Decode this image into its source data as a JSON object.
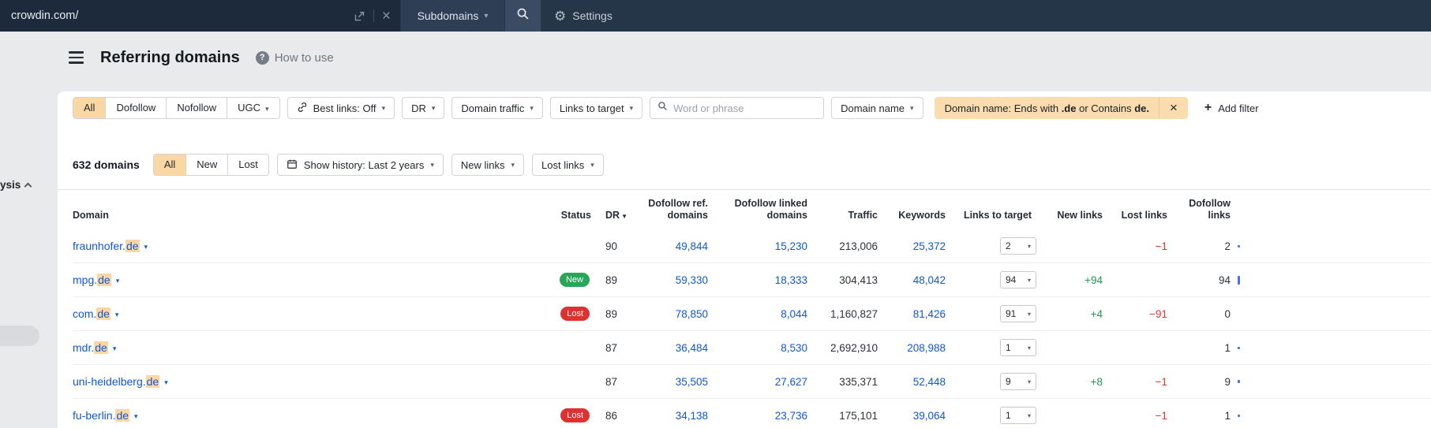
{
  "topbar": {
    "url_value": "crowdin.com/",
    "mode_selector": "Subdomains",
    "settings_label": "Settings"
  },
  "header": {
    "title": "Referring domains",
    "help_label": "How to use"
  },
  "sidebar": {
    "cut_label": "ysis"
  },
  "filters": {
    "segments": {
      "all": "All",
      "dofollow": "Dofollow",
      "nofollow": "Nofollow",
      "ugc": "UGC"
    },
    "best_links": "Best links: Off",
    "dr": "DR",
    "domain_traffic": "Domain traffic",
    "links_to_target": "Links to target",
    "search_placeholder": "Word or phrase",
    "domain_name": "Domain name",
    "chip": {
      "prefix": "Domain name: Ends with ",
      "bold1": ".de",
      "middle": " or Contains ",
      "bold2": "de."
    },
    "add_filter": "Add filter"
  },
  "toolbar": {
    "count": "632 domains",
    "segments": {
      "all": "All",
      "new": "New",
      "lost": "Lost"
    },
    "show_history": "Show history: Last 2 years",
    "new_links": "New links",
    "lost_links": "Lost links"
  },
  "table": {
    "headers": [
      "Domain",
      "Status",
      "DR",
      "Dofollow ref. domains",
      "Dofollow linked domains",
      "Traffic",
      "Keywords",
      "Links to target",
      "New links",
      "Lost links",
      "Dofollow links"
    ],
    "rows": [
      {
        "domain_prefix": "fraunhofer.",
        "domain_hl": "de",
        "status": "",
        "dr": "90",
        "dofollow_ref": "49,844",
        "dofollow_linked": "15,230",
        "traffic": "213,006",
        "keywords": "25,372",
        "links_to_target": "2",
        "new_links": "",
        "lost_links": "−1",
        "dofollow_links": "2"
      },
      {
        "domain_prefix": "mpg.",
        "domain_hl": "de",
        "status": "New",
        "dr": "89",
        "dofollow_ref": "59,330",
        "dofollow_linked": "18,333",
        "traffic": "304,413",
        "keywords": "48,042",
        "links_to_target": "94",
        "new_links": "+94",
        "lost_links": "",
        "dofollow_links": "94"
      },
      {
        "domain_prefix": "com.",
        "domain_hl": "de",
        "status": "Lost",
        "dr": "89",
        "dofollow_ref": "78,850",
        "dofollow_linked": "8,044",
        "traffic": "1,160,827",
        "keywords": "81,426",
        "links_to_target": "91",
        "new_links": "+4",
        "lost_links": "−91",
        "dofollow_links": "0"
      },
      {
        "domain_prefix": "mdr.",
        "domain_hl": "de",
        "status": "",
        "dr": "87",
        "dofollow_ref": "36,484",
        "dofollow_linked": "8,530",
        "traffic": "2,692,910",
        "keywords": "208,988",
        "links_to_target": "1",
        "new_links": "",
        "lost_links": "",
        "dofollow_links": "1"
      },
      {
        "domain_prefix": "uni-heidelberg.",
        "domain_hl": "de",
        "status": "",
        "dr": "87",
        "dofollow_ref": "35,505",
        "dofollow_linked": "27,627",
        "traffic": "335,371",
        "keywords": "52,448",
        "links_to_target": "9",
        "new_links": "+8",
        "lost_links": "−1",
        "dofollow_links": "9"
      },
      {
        "domain_prefix": "fu-berlin.",
        "domain_hl": "de",
        "status": "Lost",
        "dr": "86",
        "dofollow_ref": "34,138",
        "dofollow_linked": "23,736",
        "traffic": "175,101",
        "keywords": "39,064",
        "links_to_target": "1",
        "new_links": "",
        "lost_links": "−1",
        "dofollow_links": "1"
      }
    ]
  },
  "icons": {
    "caret_down": "▾",
    "sort_desc": "▼",
    "close": "×",
    "plus": "+",
    "gear": "⚙",
    "help": "?"
  },
  "colors": {
    "navbar": "#263649",
    "accent_orange": "#fbd7a3",
    "chip_orange": "#fbdcae",
    "link_blue": "#1158d1",
    "badge_new_green": "#27a658",
    "badge_lost_red": "#e03131",
    "positive_green": "#1f9950",
    "negative_red": "#d4382e",
    "spark_blue": "#4b74d2"
  }
}
